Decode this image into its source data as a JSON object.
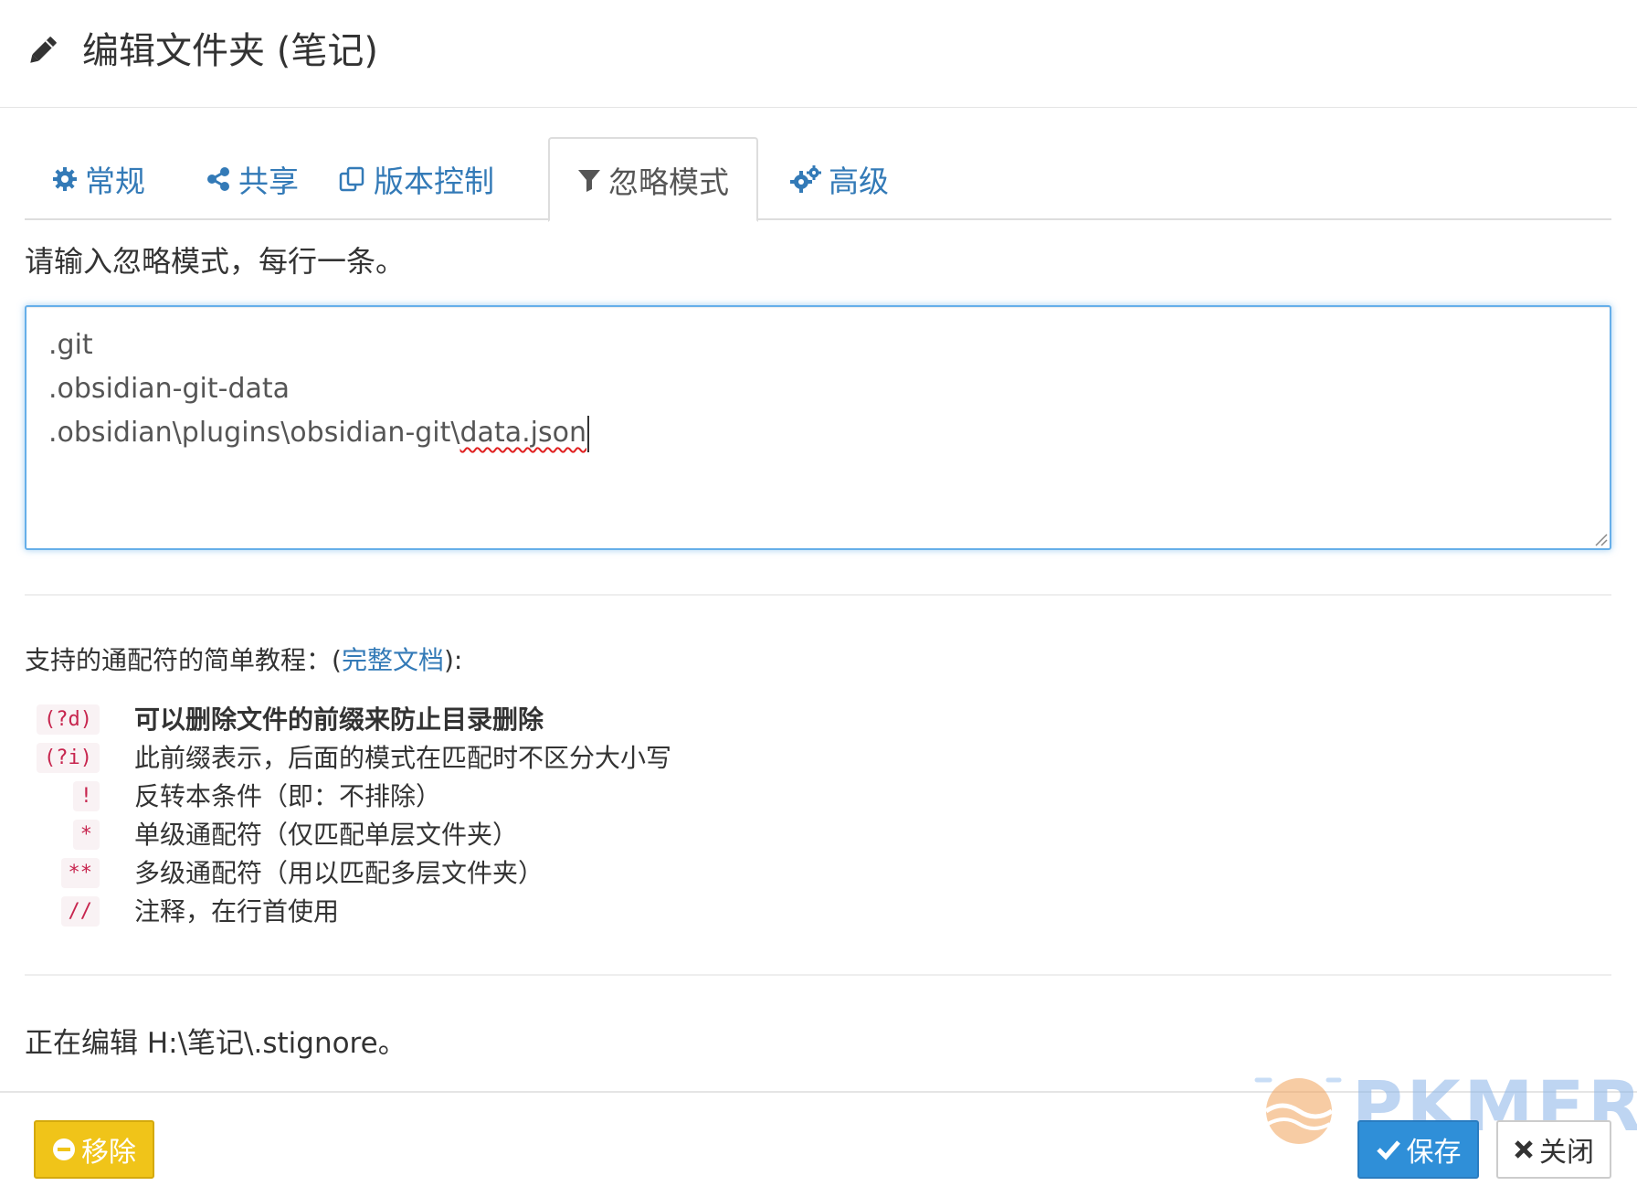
{
  "header": {
    "title": "编辑文件夹 (笔记)",
    "icon": "pencil-icon"
  },
  "tabs": [
    {
      "label": "常规",
      "icon": "gear-icon",
      "active": false
    },
    {
      "label": "共享",
      "icon": "share-icon",
      "active": false
    },
    {
      "label": "版本控制",
      "icon": "copy-icon",
      "active": false
    },
    {
      "label": "忽略模式",
      "icon": "filter-icon",
      "active": true
    },
    {
      "label": "高级",
      "icon": "gears-icon",
      "active": false
    }
  ],
  "ignore": {
    "instruction": "请输入忽略模式，每行一条。",
    "lines": [
      ".git",
      ".obsidian-git-data",
      ".obsidian\\plugins\\obsidian-git\\"
    ],
    "misspelled_tail": "data.json"
  },
  "help": {
    "intro_prefix": "支持的通配符的简单教程：",
    "intro_link_open": "(",
    "intro_link": "完整文档",
    "intro_link_close": "):",
    "patterns": [
      {
        "code": "(?d)",
        "desc": "可以删除文件的前缀来防止目录删除",
        "bold": true
      },
      {
        "code": "(?i)",
        "desc": "此前缀表示，后面的模式在匹配时不区分大小写",
        "bold": false
      },
      {
        "code": "!",
        "desc": "反转本条件（即：不排除）",
        "bold": false
      },
      {
        "code": "*",
        "desc": "单级通配符（仅匹配单层文件夹）",
        "bold": false
      },
      {
        "code": "**",
        "desc": "多级通配符（用以匹配多层文件夹）",
        "bold": false
      },
      {
        "code": "//",
        "desc": "注释，在行首使用",
        "bold": false
      }
    ]
  },
  "status": {
    "editing": "正在编辑 H:\\笔记\\.stignore。"
  },
  "footer": {
    "remove_label": "移除",
    "save_label": "保存",
    "close_label": "关闭"
  },
  "watermark": {
    "text": "PKMER"
  },
  "colors": {
    "link": "#337ab7",
    "code": "#c7254e",
    "code_bg": "#f9f2f4",
    "remove_btn": "#f0c419",
    "save_btn": "#2f8fd8",
    "focus_border": "#66afe9"
  }
}
